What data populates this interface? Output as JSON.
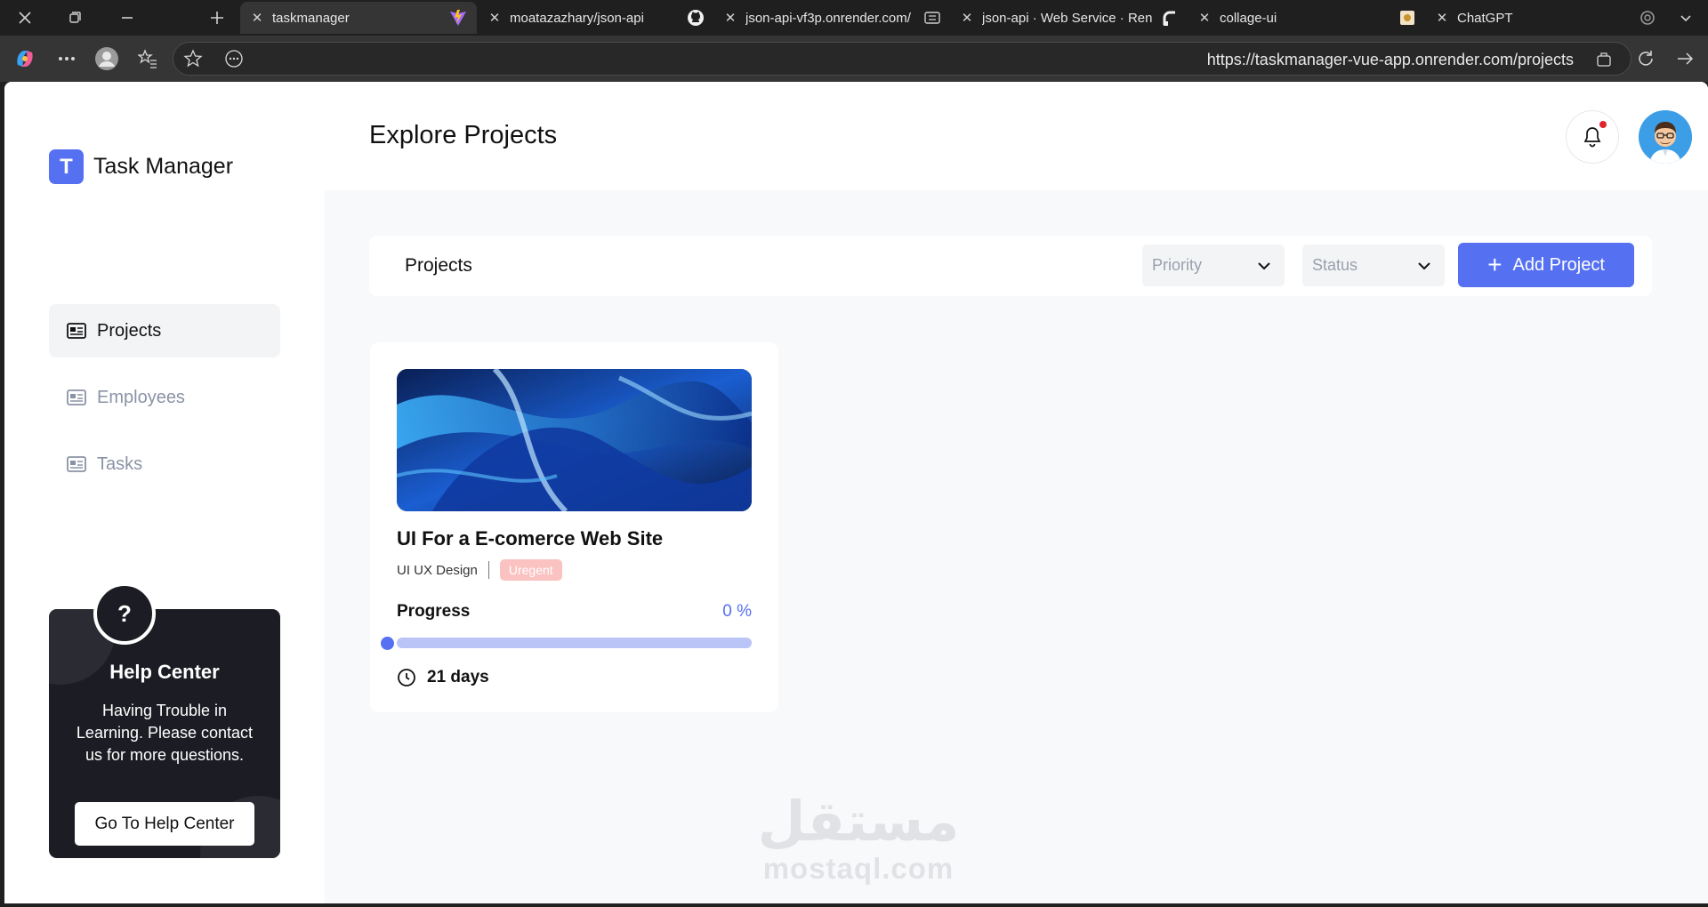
{
  "browser": {
    "tabs": [
      {
        "label": "taskmanager",
        "active": true
      },
      {
        "label": "moatazazhary/json-api",
        "active": false
      },
      {
        "label": "json-api-vf3p.onrender.com/",
        "active": false
      },
      {
        "label": "json-api · Web Service · Ren",
        "active": false
      },
      {
        "label": "collage-ui",
        "active": false
      },
      {
        "label": "ChatGPT",
        "active": false
      }
    ],
    "url": "https://taskmanager-vue-app.onrender.com/projects"
  },
  "app": {
    "logo_letter": "T",
    "logo_text": "Task Manager",
    "nav": [
      {
        "label": "Projects",
        "active": true
      },
      {
        "label": "Employees",
        "active": false
      },
      {
        "label": "Tasks",
        "active": false
      }
    ],
    "help": {
      "icon": "?",
      "title": "Help Center",
      "text": "Having Trouble in Learning. Please contact us for more questions.",
      "button": "Go To Help Center"
    },
    "page_title": "Explore Projects",
    "toolbar": {
      "title": "Projects",
      "priority_placeholder": "Priority",
      "status_placeholder": "Status",
      "add_button": "Add Project"
    },
    "project": {
      "title": "UI For a E-comerce Web Site",
      "category": "UI UX Design",
      "priority_badge": "Uregent",
      "progress_label": "Progress",
      "progress_text": "0 %",
      "progress_percent": 0,
      "days": "21 days"
    }
  },
  "watermark": {
    "arabic": "مستقل",
    "latin": "mostaql.com"
  },
  "colors": {
    "accent": "#5570f1",
    "badge": "#fbc2c2",
    "help_bg": "#1c1d24",
    "notification_dot": "#e0242b"
  }
}
